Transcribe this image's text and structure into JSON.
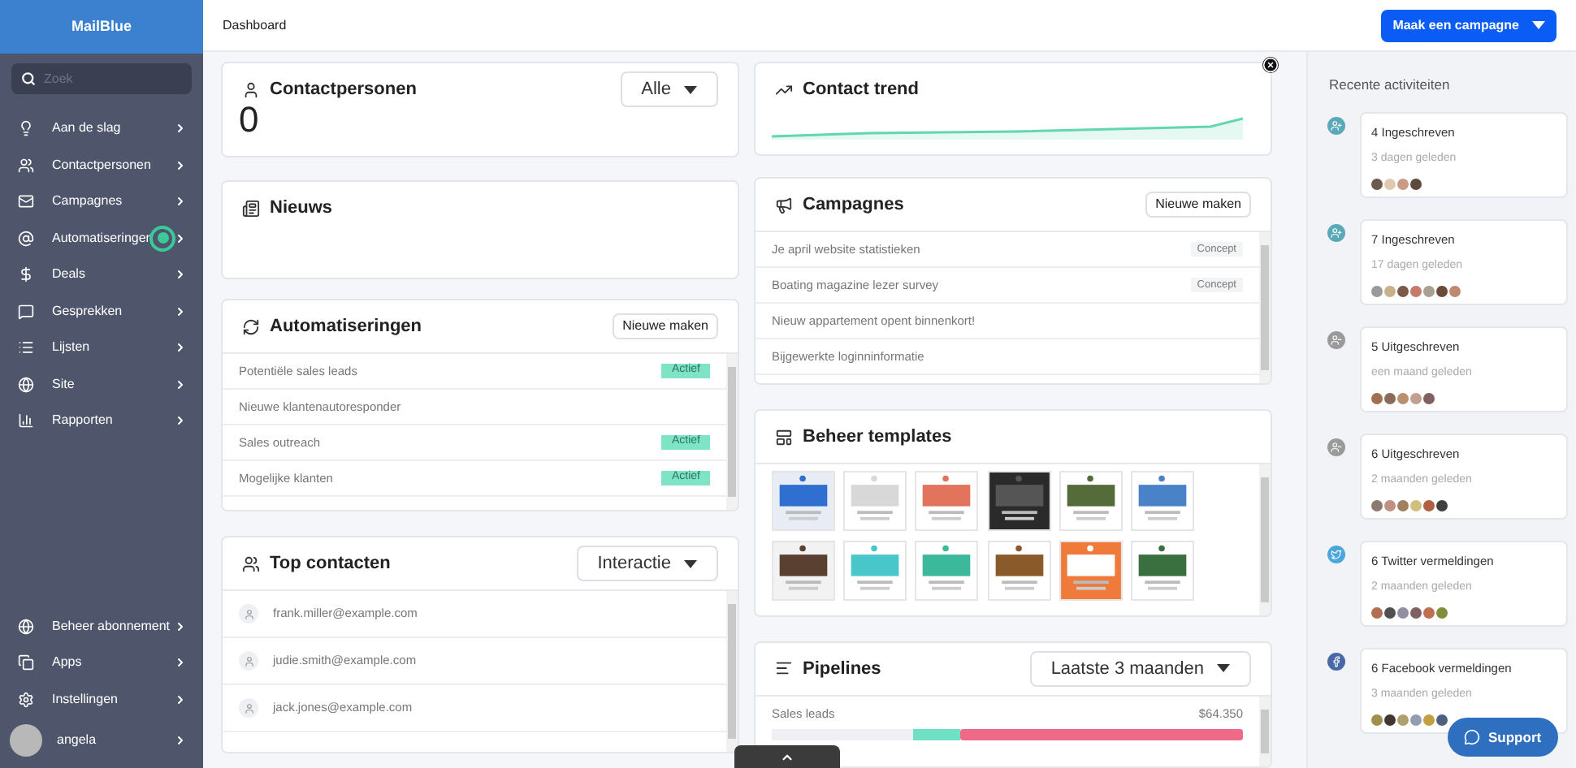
{
  "sidebar": {
    "brand": "MailBlue",
    "search": {
      "placeholder": "Zoek"
    },
    "items": [
      {
        "label": "Aan de slag",
        "notification": false
      },
      {
        "label": "Contactpersonen",
        "notification": false
      },
      {
        "label": "Campagnes",
        "notification": false
      },
      {
        "label": "Automatiseringen",
        "notification": true
      },
      {
        "label": "Deals",
        "notification": false
      },
      {
        "label": "Gesprekken",
        "notification": false
      },
      {
        "label": "Lijsten",
        "notification": false
      },
      {
        "label": "Site",
        "notification": false
      },
      {
        "label": "Rapporten",
        "notification": false
      }
    ],
    "bottom_items": [
      {
        "label": "Beheer abonnement"
      },
      {
        "label": "Apps"
      },
      {
        "label": "Instellingen"
      }
    ],
    "user": {
      "name": "angela"
    }
  },
  "header": {
    "title": "Dashboard",
    "primary_button": "Maak een campagne"
  },
  "contacts_card": {
    "title": "Contactpersonen",
    "filter": "Alle",
    "count": "0"
  },
  "news_card": {
    "title": "Nieuws"
  },
  "automations_card": {
    "title": "Automatiseringen",
    "button": "Nieuwe maken",
    "rows": [
      {
        "name": "Potentiële sales leads",
        "status": "Actief"
      },
      {
        "name": "Nieuwe klantenautoresponder"
      },
      {
        "name": "Sales outreach",
        "status": "Actief"
      },
      {
        "name": "Mogelijke klanten",
        "status": "Actief"
      }
    ]
  },
  "top_contacts_card": {
    "title": "Top contacten",
    "filter": "Interactie",
    "rows": [
      {
        "email": "frank.miller@example.com"
      },
      {
        "email": "judie.smith@example.com"
      },
      {
        "email": "jack.jones@example.com"
      }
    ]
  },
  "trend_card": {
    "title": "Contact trend"
  },
  "campaigns_card": {
    "title": "Campagnes",
    "button": "Nieuwe maken",
    "rows": [
      {
        "name": "Je april website statistieken",
        "status": "Concept"
      },
      {
        "name": "Boating magazine lezer survey",
        "status": "Concept"
      },
      {
        "name": "Nieuw appartement opent binnenkort!"
      },
      {
        "name": "Bijgewerkte loginninformatie"
      }
    ]
  },
  "templates_card": {
    "title": "Beheer templates"
  },
  "pipelines_card": {
    "title": "Pipelines",
    "filter": "Laatste 3 maanden",
    "rows": [
      {
        "name": "Sales leads",
        "amount": "$64.350"
      }
    ]
  },
  "activity": {
    "title": "Recente activiteiten",
    "items": [
      {
        "kind": "subscribed",
        "title": "4 Ingeschreven",
        "time": "3 dagen geleden",
        "avatars": [
          {
            "color": "#6b5a4e"
          },
          {
            "color": "#e0c9b0"
          },
          {
            "color": "#c99a86"
          },
          {
            "color": "#5c4a3c"
          }
        ]
      },
      {
        "kind": "subscribed",
        "title": "7 Ingeschreven",
        "time": "17 dagen geleden",
        "avatars": [
          {
            "color": "#9a9a9a"
          },
          {
            "color": "#c8b08a"
          },
          {
            "color": "#7a5a48"
          },
          {
            "color": "#c77a6a"
          },
          {
            "color": "#a8a090"
          },
          {
            "color": "#6a4a3a"
          },
          {
            "color": "#c08870"
          }
        ]
      },
      {
        "kind": "unsubscribed",
        "title": "5 Uitgeschreven",
        "time": "een maand geleden",
        "avatars": [
          {
            "color": "#a07050"
          },
          {
            "color": "#8a6a5a"
          },
          {
            "color": "#b89070"
          },
          {
            "color": "#c0a090"
          },
          {
            "color": "#806060"
          }
        ]
      },
      {
        "kind": "unsubscribed",
        "title": "6 Uitgeschreven",
        "time": "2 maanden geleden",
        "avatars": [
          {
            "color": "#8a7a70"
          },
          {
            "color": "#c09080"
          },
          {
            "color": "#a08060"
          },
          {
            "color": "#d0c080"
          },
          {
            "color": "#b06040"
          },
          {
            "color": "#404040"
          }
        ]
      },
      {
        "kind": "twitter",
        "title": "6 Twitter vermeldingen",
        "time": "2 maanden geleden",
        "avatars": [
          {
            "color": "#b07050"
          },
          {
            "color": "#505050"
          },
          {
            "color": "#9090a0"
          },
          {
            "color": "#806060"
          },
          {
            "color": "#c07050"
          },
          {
            "color": "#80903a"
          }
        ]
      },
      {
        "kind": "facebook",
        "title": "6 Facebook vermeldingen",
        "time": "3 maanden geleden",
        "avatars": [
          {
            "color": "#a09050"
          },
          {
            "color": "#403830"
          },
          {
            "color": "#b0a070"
          },
          {
            "color": "#90a0b0"
          },
          {
            "color": "#c0a040"
          },
          {
            "color": "#506080"
          }
        ]
      }
    ]
  },
  "support_button": "Support"
}
